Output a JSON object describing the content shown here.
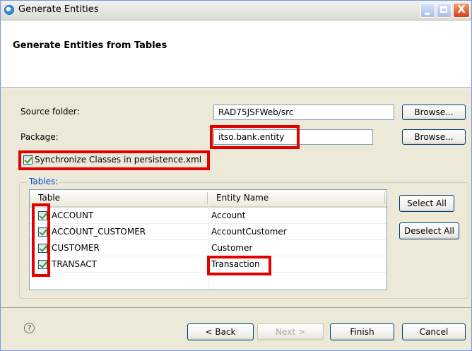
{
  "window": {
    "title": "Generate Entities",
    "app_icon": "eclipse-icon",
    "controls": [
      "minimize-icon",
      "maximize-icon",
      "close-icon"
    ],
    "close_glyph": "X"
  },
  "banner": {
    "title": "Generate Entities from Tables"
  },
  "form": {
    "source_folder_label": "Source folder:",
    "source_folder_value": "RAD75JSFWeb/src",
    "package_label": "Package:",
    "package_value": "itso.bank.entity",
    "browse_label": "Browse...",
    "sync_label": "Synchronize Classes in persistence.xml",
    "sync_checked": true
  },
  "tables": {
    "group_label": "Tables:",
    "columns": [
      "Table",
      "Entity Name"
    ],
    "rows": [
      {
        "table": "ACCOUNT",
        "entity": "Account",
        "checked": true
      },
      {
        "table": "ACCOUNT_CUSTOMER",
        "entity": "AccountCustomer",
        "checked": true
      },
      {
        "table": "CUSTOMER",
        "entity": "Customer",
        "checked": true
      },
      {
        "table": "TRANSACT",
        "entity": "Transaction",
        "checked": true
      }
    ],
    "select_all": "Select All",
    "deselect_all": "Deselect All"
  },
  "footer": {
    "help_glyph": "?",
    "back": "< Back",
    "next": "Next >",
    "finish": "Finish",
    "cancel": "Cancel"
  },
  "colors": {
    "highlight": "#e50000",
    "group_label": "#0046d5",
    "check": "#21a121"
  }
}
